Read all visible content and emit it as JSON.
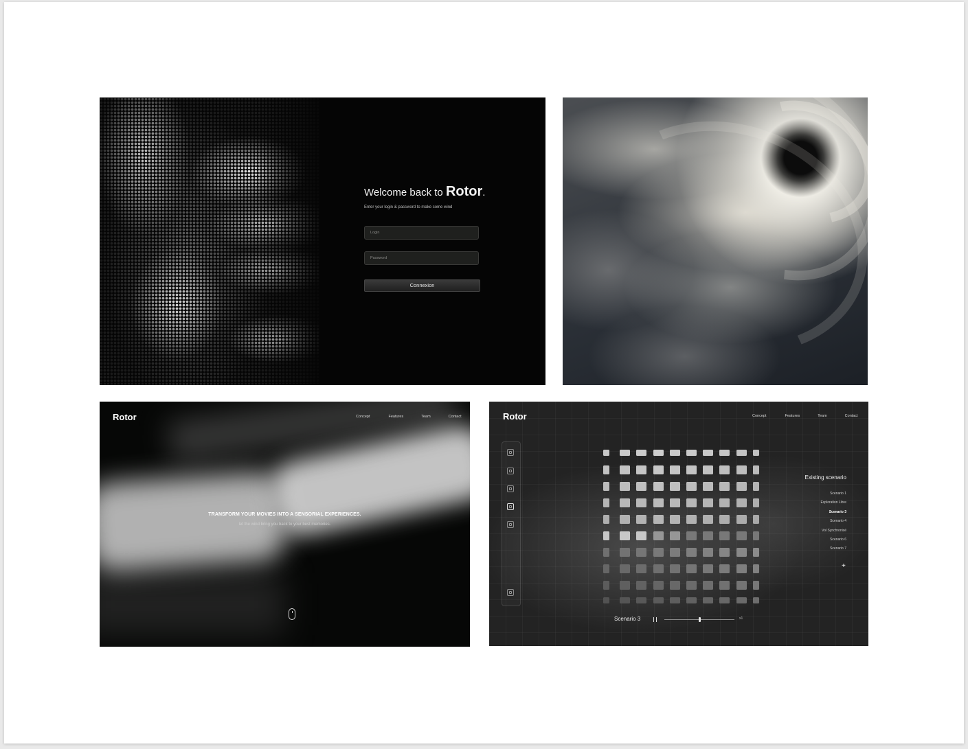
{
  "login_screen": {
    "welcome_prefix": "Welcome back to",
    "brand": "Rotor",
    "brand_suffix": ".",
    "subtitle": "Enter your login & password to make some wind",
    "login_placeholder": "Login",
    "password_placeholder": "Password",
    "submit_label": "Connexion"
  },
  "hero_screen": {
    "logo": "Rotor",
    "nav": [
      "Concept",
      "Features",
      "Team",
      "Contact"
    ],
    "headline": "TRANSFORM YOUR MOVIES INTO A  SENSORIAL EXPERIENCES.",
    "tagline": "let the wind bring you back to your best memories.",
    "scroll_icon": "mouse-scroll-icon"
  },
  "app_screen": {
    "logo": "Rotor",
    "nav": [
      "Concept",
      "Features",
      "Team",
      "Contact"
    ],
    "toolbar_icons": [
      "wind-icon",
      "grid-icon",
      "gauge-icon",
      "scenario-icon",
      "fan-icon",
      "settings-icon"
    ],
    "active_tool": 3,
    "grid_rows": 10,
    "grid_cols": 10,
    "sidebar_title": "Existing scenario",
    "scenarios": [
      "Scenario 1",
      "Exploration Libre",
      "Scenario 3",
      "Scenario 4",
      "Vol Synchronisé",
      "Scenario 6",
      "Scenario 7"
    ],
    "active_scenario": 2,
    "add_label": "+",
    "player_label": "Scenario 3",
    "speed_label": "x1",
    "progress": 0.5
  },
  "colors": {
    "dark_bg": "#050505",
    "app_bg": "#232323",
    "text_light": "#f2f2f2"
  }
}
